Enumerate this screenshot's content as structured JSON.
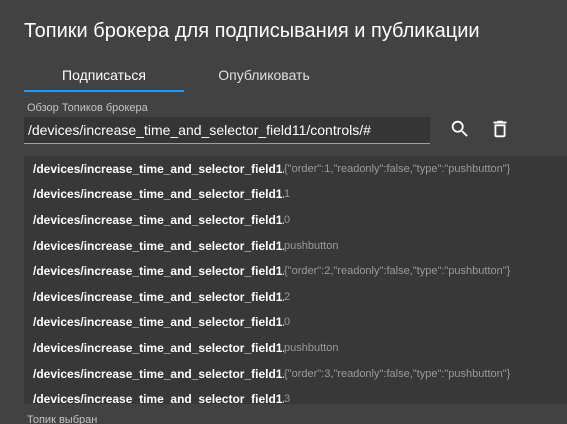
{
  "dialog": {
    "title": "Топики брокера для подписывания и публикации"
  },
  "tabs": [
    {
      "label": "Подписаться",
      "active": true
    },
    {
      "label": "Опубликовать",
      "active": false
    }
  ],
  "browse": {
    "label": "Обзор Топиков брокера",
    "value": "/devices/increase_time_and_selector_field11/controls/#",
    "search_icon": "search-icon",
    "delete_icon": "trash-icon"
  },
  "topics": [
    {
      "topic": "/devices/increase_time_and_selector_field1...",
      "value": "{\"order\":1,\"readonly\":false,\"type\":\"pushbutton\"}"
    },
    {
      "topic": "/devices/increase_time_and_selector_field1...",
      "value": "1"
    },
    {
      "topic": "/devices/increase_time_and_selector_field1...",
      "value": "0"
    },
    {
      "topic": "/devices/increase_time_and_selector_field1...",
      "value": "pushbutton"
    },
    {
      "topic": "/devices/increase_time_and_selector_field1...",
      "value": "{\"order\":2,\"readonly\":false,\"type\":\"pushbutton\"}"
    },
    {
      "topic": "/devices/increase_time_and_selector_field1...",
      "value": "2"
    },
    {
      "topic": "/devices/increase_time_and_selector_field1...",
      "value": "0"
    },
    {
      "topic": "/devices/increase_time_and_selector_field1...",
      "value": "pushbutton"
    },
    {
      "topic": "/devices/increase_time_and_selector_field1...",
      "value": "{\"order\":3,\"readonly\":false,\"type\":\"pushbutton\"}"
    },
    {
      "topic": "/devices/increase_time_and_selector_field1...",
      "value": "3"
    }
  ],
  "footer": {
    "label": "Топик выбран"
  },
  "colors": {
    "background": "#424242",
    "accent": "#2196f3",
    "list_background": "#383838"
  }
}
